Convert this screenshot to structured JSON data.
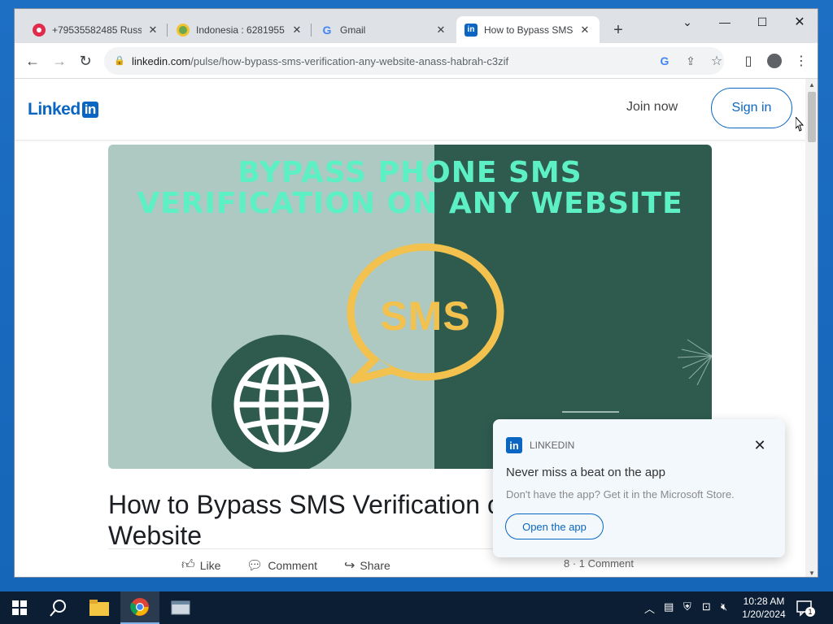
{
  "browser": {
    "tabs": [
      {
        "label": "+79535582485 Russ",
        "favicon": "red-circle",
        "active": false
      },
      {
        "label": "Indonesia : 6281955",
        "favicon": "green-circle",
        "active": false
      },
      {
        "label": "Gmail",
        "favicon": "google-g",
        "active": false
      },
      {
        "label": "How to Bypass SMS",
        "favicon": "linkedin",
        "active": true
      }
    ],
    "url_domain": "linkedin.com",
    "url_path": "/pulse/how-bypass-sms-verification-any-website-anass-habrah-c3zif"
  },
  "header": {
    "logo_text": "Linked",
    "logo_badge": "in",
    "join_label": "Join now",
    "signin_label": "Sign in"
  },
  "hero": {
    "headline_line1": "BYPASS PHONE SMS",
    "headline_line2": "VERIFICATION ON ANY WEBSITE",
    "bubble_text": "SMS"
  },
  "article": {
    "title": "How to Bypass SMS Verification on Any Website",
    "like_label": "Like",
    "comment_label": "Comment",
    "share_label": "Share",
    "reactions": "8 · 1 Comment"
  },
  "toast": {
    "brand": "LINKEDIN",
    "heading": "Never miss a beat on the app",
    "body": "Don't have the app? Get it in the Microsoft Store.",
    "button": "Open the app"
  },
  "taskbar": {
    "time": "10:28 AM",
    "date": "1/20/2024",
    "notification_count": "1"
  },
  "colors": {
    "linkedin_blue": "#0a66c2",
    "hero_left": "#adc9c2",
    "hero_right": "#2f5b4f",
    "hero_text": "#5cf0c4",
    "bubble": "#f2c14e"
  }
}
